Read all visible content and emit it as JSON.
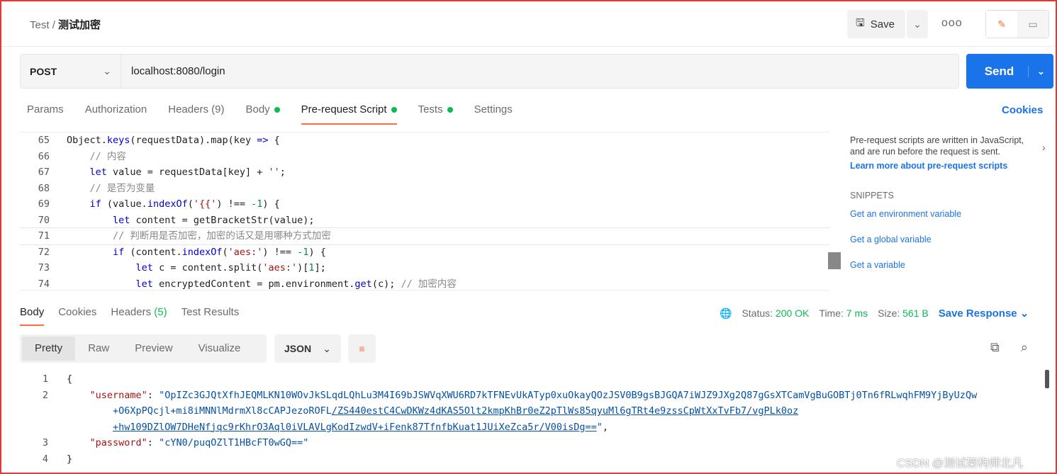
{
  "header": {
    "collection": "Test",
    "separator": "/",
    "request_name": "测试加密",
    "save_label": "Save",
    "more": "ooo"
  },
  "request": {
    "method": "POST",
    "url": "localhost:8080/login",
    "send_label": "Send"
  },
  "tabs": [
    {
      "label": "Params"
    },
    {
      "label": "Authorization"
    },
    {
      "label": "Headers",
      "count": "(9)"
    },
    {
      "label": "Body",
      "dot": true
    },
    {
      "label": "Pre-request Script",
      "dot": true,
      "active": true
    },
    {
      "label": "Tests",
      "dot": true
    },
    {
      "label": "Settings"
    }
  ],
  "cookies_label": "Cookies",
  "editor": {
    "lines": [
      {
        "n": "65",
        "html": "Object.<span class='kw'>keys</span>(requestData).map(key <span class='kw'>=&gt;</span> {"
      },
      {
        "n": "66",
        "html": "    <span class='cm'>// 内容</span>"
      },
      {
        "n": "67",
        "html": "    <span class='kw'>let</span> value = requestData[key] + <span class='str'>''</span>;"
      },
      {
        "n": "68",
        "html": "    <span class='cm'>// 是否为变量</span>"
      },
      {
        "n": "69",
        "html": "    <span class='kw'>if</span> (value.<span class='kw'>indexOf</span>(<span class='str'>'{{'</span>) !== <span class='num'>-1</span>) {"
      },
      {
        "n": "70",
        "html": "        <span class='kw'>let</span> content = getBracketStr(value);"
      },
      {
        "n": "71",
        "html": "        <span class='cm'>// 判断用是否加密，加密的话又是用哪种方式加密</span>",
        "cur": true
      },
      {
        "n": "72",
        "html": "        <span class='kw'>if</span> (content.<span class='kw'>indexOf</span>(<span class='str'>'aes:'</span>) !== <span class='num'>-1</span>) {"
      },
      {
        "n": "73",
        "html": "            <span class='kw'>let</span> c = content.split(<span class='str'>'aes:'</span>)[<span class='num'>1</span>];"
      },
      {
        "n": "74",
        "html": "            <span class='kw'>let</span> encryptedContent = pm.environment.<span class='kw'>get</span>(c); <span class='cm'>// 加密内容</span>"
      }
    ]
  },
  "sidebar": {
    "description": "Pre-request scripts are written in JavaScript, and are run before the request is sent.",
    "learn_more": "Learn more about pre-request scripts",
    "snippets_title": "SNIPPETS",
    "snippets": [
      "Get an environment variable",
      "Get a global variable",
      "Get a variable"
    ]
  },
  "response": {
    "tabs": [
      {
        "label": "Body",
        "active": true
      },
      {
        "label": "Cookies"
      },
      {
        "label": "Headers",
        "count": "(5)"
      },
      {
        "label": "Test Results"
      }
    ],
    "status_label": "Status:",
    "status": "200 OK",
    "time_label": "Time:",
    "time": "7 ms",
    "size_label": "Size:",
    "size": "561 B",
    "save_response": "Save Response",
    "views": [
      "Pretty",
      "Raw",
      "Preview",
      "Visualize"
    ],
    "active_view": "Pretty",
    "format": "JSON",
    "body": {
      "username_key": "\"username\"",
      "password_key": "\"password\"",
      "username_l1": "\"OpIZc3GJQtXfhJEQMLKN10WOvJkSLqdLQhLu3M4I69bJSWVqXWU6RD7kTFNEvUkATyp0xuOkayQOzJSV0B9gsBJGQA7iWJZ9JXg2Q87gGsXTCamVgBuGOBTj0Tn6fRLwqhFM9YjByUzQw",
      "username_l2a": "+O6XpPQcjl+mi8iMNNlMdrmXl8cCAPJezoROFL",
      "username_l2b": "/ZS440estC4CwDKWz4dKAS5Olt2kmpKhBr0eZ2pTlWs85qyuMl6gTRt4e9zssCpWtXxTvFb7/vgPLk0oz",
      "username_l3": "+hw109DZlOW7DHeNfjqc9rKhrO3Aql0iVLAVLgKodIzwdV+iFenk87TfnfbKuat1JUiXeZca5r/V00isDg==",
      "password_val": "\"cYN0/puqOZlT1HBcFT0wGQ==\""
    }
  },
  "watermark": "CSDN @测试架构师北凡",
  "colors": {
    "accent": "#ff6c37",
    "primary": "#1a73e8",
    "success": "#0cbb52"
  }
}
